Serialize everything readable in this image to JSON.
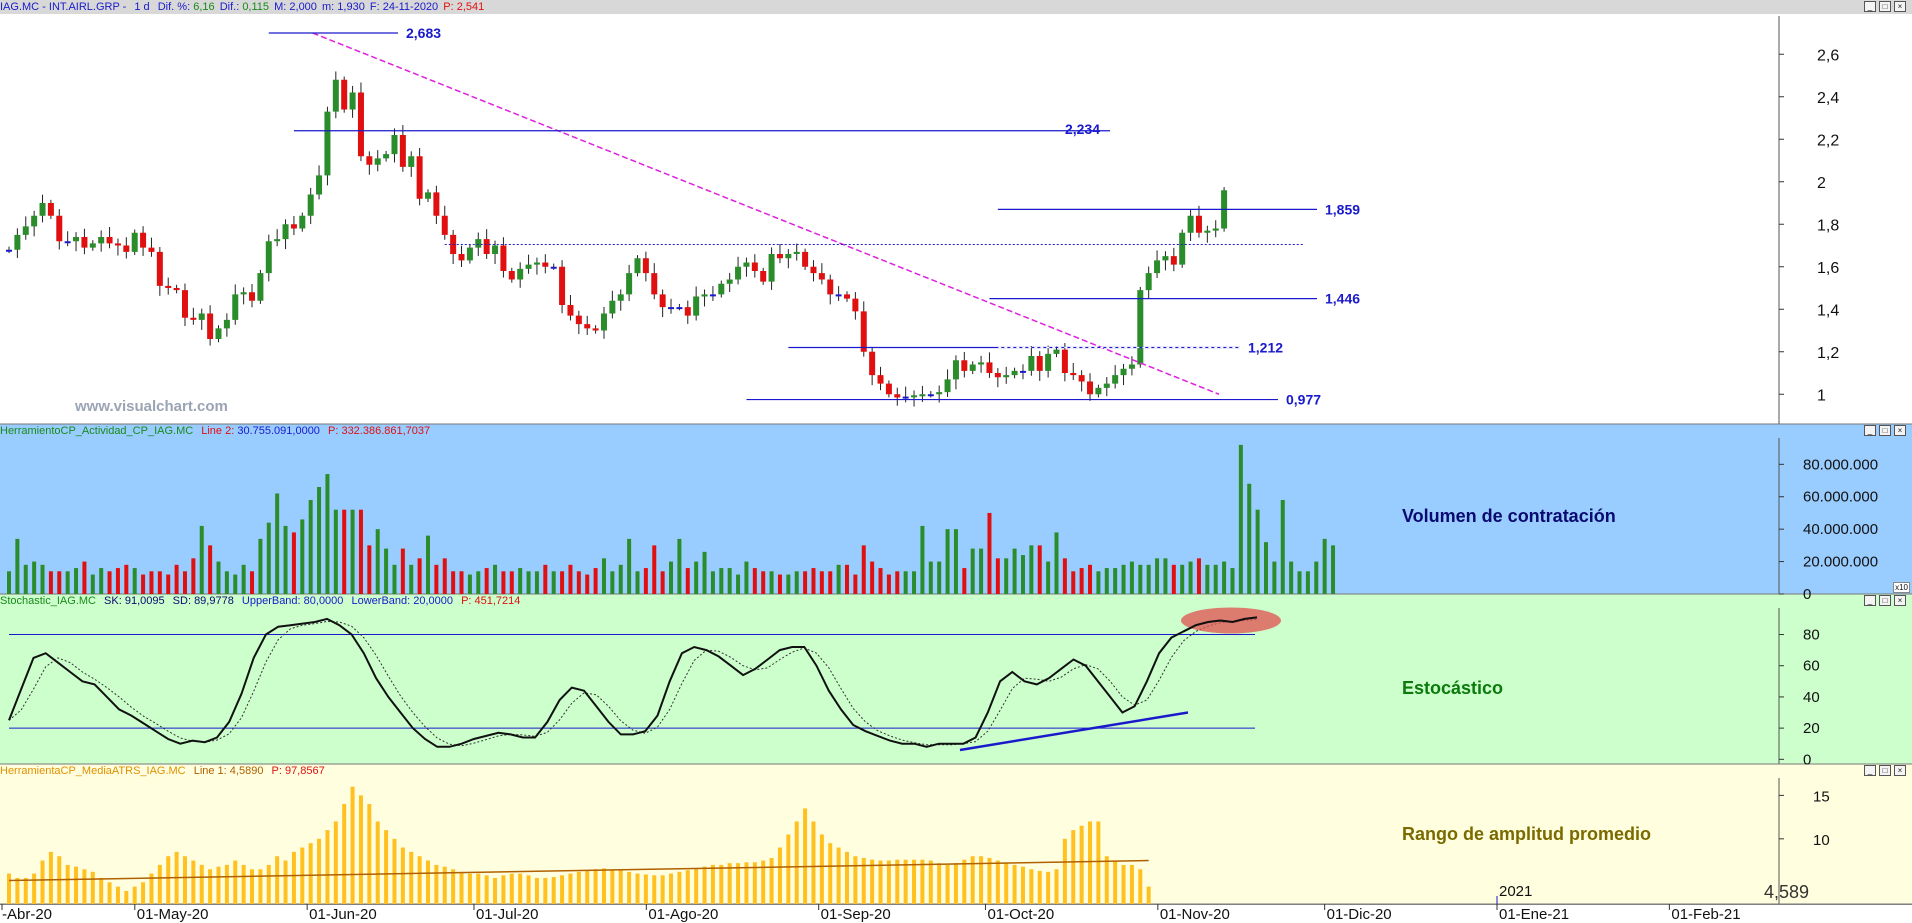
{
  "header": {
    "symbol": "IAG.MC - INT.AIRL.GRP -",
    "period": "1 d",
    "dif_pct_label": "Dif. %:",
    "dif_pct": "6,16",
    "dif_label": "Dif.:",
    "dif": "0,115",
    "max_label": "M:",
    "max": "2,000",
    "min_label": "m:",
    "min": "1,930",
    "date_label": "F:",
    "date": "24-11-2020",
    "price_label": "P:",
    "price": "2,541"
  },
  "watermark": "www.visualchart.com",
  "volume_pane": {
    "header_name": "HerramientoCP_Actividad_CP_IAG.MC",
    "header_line": "Line 2:",
    "header_line_val": "30.755.091,0000",
    "header_p": "P: 332.386.861,7037",
    "title": "Volumen de contratación",
    "corner_tag": "x10"
  },
  "stoch_pane": {
    "header_name": "Stochastic_IAG.MC",
    "header_sk": "SK: 91,0095",
    "header_sd": "SD: 89,9778",
    "header_ub": "UpperBand: 80,0000",
    "header_lb": "LowerBand: 20,0000",
    "header_p": "P: 451,7214",
    "title": "Estocástico"
  },
  "atr_pane": {
    "header_name": "HerramientaCP_MediaATRS_IAG.MC",
    "header_line": "Line 1: 4,5890",
    "header_p": "P: 97,8567",
    "title": "Rango de amplitud promedio",
    "last_value": "4,589"
  },
  "window_controls": [
    "_",
    "□",
    "×"
  ],
  "x_axis": {
    "labels": [
      "-Abr-20",
      "01-May-20",
      "01-Jun-20",
      "01-Jul-20",
      "01-Ago-20",
      "01-Sep-20",
      "01-Oct-20",
      "01-Nov-20",
      "01-Dic-20",
      "01-Ene-21",
      "01-Feb-21"
    ],
    "year_marker": "2021"
  },
  "colors": {
    "up": "#2a8c2a",
    "down": "#e01010",
    "flat": "#1a1acc",
    "trendline": "#e020e0",
    "level": "#1a1acc",
    "volume_bg": "#99ccff",
    "stoch_bg": "#ccffcc",
    "atr_bg": "#ffffe0",
    "atr_bar": "#ffc020",
    "atr_line": "#b06000",
    "highlight": "#e05050"
  },
  "chart_data": [
    {
      "type": "candlestick",
      "title": "IAG.MC - INT.AIRL.GRP - 1 d",
      "y_ticks": [
        "2,6",
        "2,4",
        "2,2",
        "2",
        "1,8",
        "1,6",
        "1,4",
        "1,2",
        "1"
      ],
      "y_range": [
        0.86,
        2.78
      ],
      "levels": [
        {
          "label": "2,683",
          "value": 2.7
        },
        {
          "label": "2,234",
          "value": 2.24
        },
        {
          "label": "1,859",
          "value": 1.87
        },
        {
          "label": "1,446",
          "value": 1.45
        },
        {
          "label": "1,212",
          "value": 1.22
        },
        {
          "label": "0,977",
          "value": 0.975
        }
      ],
      "dotted_resistance": 1.705,
      "trendline": {
        "from": {
          "date": "2020-06-02",
          "value": 2.7
        },
        "to": {
          "date": "2020-11-12",
          "value": 1.0
        }
      },
      "close_series": [
        1.68,
        1.75,
        1.79,
        1.84,
        1.9,
        1.84,
        1.72,
        1.72,
        1.74,
        1.69,
        1.71,
        1.74,
        1.71,
        1.7,
        1.67,
        1.76,
        1.69,
        1.67,
        1.51,
        1.5,
        1.49,
        1.36,
        1.35,
        1.38,
        1.26,
        1.31,
        1.35,
        1.47,
        1.48,
        1.44,
        1.57,
        1.72,
        1.73,
        1.8,
        1.78,
        1.84,
        1.94,
        2.03,
        2.33,
        2.48,
        2.34,
        2.42,
        2.12,
        2.08,
        2.11,
        2.13,
        2.22,
        2.07,
        2.12,
        1.92,
        1.95,
        1.84,
        1.75,
        1.66,
        1.63,
        1.69,
        1.73,
        1.66,
        1.7,
        1.58,
        1.54,
        1.59,
        1.61,
        1.62,
        1.6,
        1.6,
        1.42,
        1.37,
        1.33,
        1.31,
        1.3,
        1.38,
        1.44,
        1.47,
        1.57,
        1.64,
        1.57,
        1.47,
        1.41,
        1.41,
        1.41,
        1.37,
        1.46,
        1.47,
        1.47,
        1.52,
        1.54,
        1.6,
        1.62,
        1.58,
        1.53,
        1.66,
        1.64,
        1.66,
        1.67,
        1.6,
        1.57,
        1.54,
        1.47,
        1.47,
        1.45,
        1.39,
        1.2,
        1.09,
        1.05,
        1.0,
        0.985,
        0.989,
        0.995,
        1.0,
        1.0,
        1.01,
        1.07,
        1.16,
        1.11,
        1.14,
        1.15,
        1.1,
        1.08,
        1.09,
        1.11,
        1.11,
        1.18,
        1.11,
        1.19,
        1.21,
        1.1,
        1.09,
        1.06,
        1.0,
        1.03,
        1.05,
        1.09,
        1.12,
        1.14,
        1.49,
        1.57,
        1.63,
        1.65,
        1.61,
        1.76,
        1.84,
        1.76,
        1.77,
        1.78,
        1.96
      ]
    },
    {
      "type": "bar",
      "title": "Volumen de contratación",
      "y_ticks": [
        "80.000.000",
        "60.000.000",
        "40.000.000",
        "20.000.000",
        "0"
      ],
      "y_range": [
        0,
        95000000
      ],
      "values_millions": [
        14,
        34,
        18,
        20,
        18,
        14,
        14,
        14,
        16,
        20,
        12,
        16,
        14,
        16,
        18,
        16,
        12,
        14,
        14,
        12,
        18,
        14,
        22,
        42,
        30,
        20,
        14,
        12,
        18,
        14,
        34,
        44,
        62,
        42,
        38,
        46,
        58,
        66,
        74,
        52,
        52,
        52,
        52,
        30,
        40,
        28,
        18,
        28,
        18,
        22,
        36,
        18,
        22,
        14,
        14,
        12,
        14,
        16,
        18,
        14,
        14,
        16,
        14,
        14,
        18,
        14,
        14,
        18,
        14,
        12,
        16,
        22,
        14,
        18,
        34,
        14,
        16,
        30,
        14,
        20,
        34,
        16,
        20,
        26,
        14,
        16,
        16,
        12,
        20,
        16,
        14,
        14,
        12,
        12,
        14,
        14,
        16,
        14,
        14,
        18,
        18,
        12,
        30,
        20,
        16,
        12,
        14,
        14,
        14,
        42,
        20,
        20,
        40,
        40,
        16,
        28,
        28,
        50,
        22,
        22,
        28,
        24,
        30,
        30,
        20,
        38,
        22,
        14,
        16,
        18,
        14,
        16,
        16,
        18,
        20,
        18,
        18,
        22,
        22,
        18,
        18,
        20,
        22,
        18,
        18,
        20,
        16,
        92,
        68,
        52,
        32,
        20,
        58,
        20,
        14,
        14,
        20,
        34,
        30
      ]
    },
    {
      "type": "line",
      "title": "Estocástico",
      "y_ticks": [
        "80",
        "60",
        "40",
        "20",
        "0"
      ],
      "y_range": [
        -3,
        97
      ],
      "bands": [
        80,
        20
      ],
      "sk": [
        25,
        45,
        65,
        68,
        62,
        56,
        50,
        48,
        40,
        32,
        28,
        23,
        18,
        13,
        10,
        12,
        11,
        14,
        24,
        42,
        65,
        80,
        85,
        86,
        87,
        88,
        90,
        86,
        80,
        68,
        52,
        40,
        30,
        20,
        13,
        8,
        8,
        10,
        13,
        15,
        17,
        16,
        14,
        14,
        24,
        38,
        46,
        44,
        34,
        24,
        16,
        16,
        18,
        28,
        50,
        68,
        72,
        70,
        66,
        60,
        54,
        58,
        64,
        70,
        72,
        72,
        60,
        44,
        32,
        22,
        18,
        15,
        12,
        10,
        10,
        8,
        10,
        10,
        10,
        14,
        30,
        50,
        56,
        50,
        48,
        52,
        58,
        64,
        60,
        50,
        40,
        30,
        34,
        50,
        68,
        78,
        82,
        86,
        88,
        89,
        88,
        90,
        91
      ],
      "trend_segment": {
        "from": 6,
        "to": 30
      },
      "highlight": "overbought region at end of series"
    },
    {
      "type": "bar",
      "title": "Rango de amplitud promedio",
      "y_ticks": [
        "15",
        "10"
      ],
      "y_range": [
        2.5,
        17
      ],
      "last": 4.589,
      "values": [
        6,
        5.5,
        5.5,
        6,
        7.5,
        8.5,
        8,
        7,
        6.8,
        6.5,
        6.2,
        5.5,
        5,
        4.5,
        4,
        4.5,
        5,
        6,
        7,
        8,
        8.5,
        8,
        7.5,
        7,
        6.5,
        6.8,
        7,
        7.5,
        7,
        6.5,
        6.5,
        7,
        8,
        7.5,
        8.5,
        9,
        9.5,
        10,
        11,
        12,
        14,
        16,
        15,
        14,
        12,
        11,
        10,
        9,
        8.5,
        8,
        7.5,
        7,
        6.8,
        6.5,
        6.2,
        6,
        6,
        5.8,
        5.5,
        5.8,
        6,
        6,
        5.8,
        5.5,
        5.5,
        5.6,
        5.8,
        6,
        6.2,
        6.4,
        6.5,
        6.6,
        6.5,
        6.4,
        6.2,
        6,
        5.9,
        5.8,
        5.8,
        6,
        6.2,
        6.4,
        6.6,
        6.8,
        7,
        7,
        7.2,
        7.2,
        7.3,
        7.3,
        7.5,
        7.8,
        9,
        10.5,
        12,
        13.5,
        12,
        10.5,
        9.5,
        9,
        8.5,
        8,
        7.8,
        7.6,
        7.5,
        7.5,
        7.6,
        7.6,
        7.6,
        7.6,
        7.5,
        7.2,
        7,
        7.2,
        7.6,
        8,
        8,
        7.8,
        7.5,
        7.2,
        7,
        6.8,
        6.5,
        6.3,
        6.2,
        6.5,
        10,
        11,
        11.5,
        12,
        12,
        8,
        7.5,
        7,
        7,
        6.5,
        4.5
      ],
      "avg_line": [
        5.2,
        7.5
      ]
    }
  ]
}
